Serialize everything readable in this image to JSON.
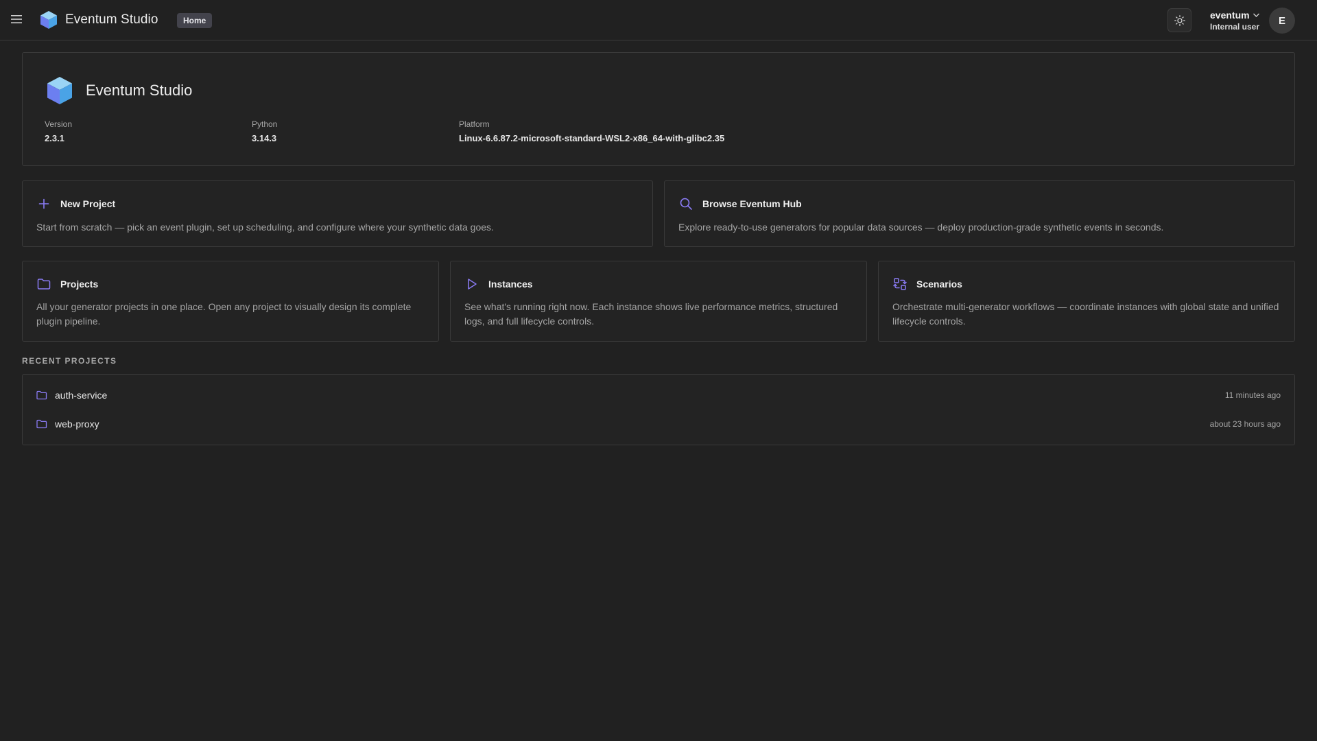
{
  "header": {
    "app_title": "Eventum Studio",
    "breadcrumb": "Home",
    "user": {
      "name": "eventum",
      "role": "Internal user",
      "avatar_initial": "E"
    }
  },
  "info": {
    "title": "Eventum Studio",
    "version_label": "Version",
    "version": "2.3.1",
    "python_label": "Python",
    "python": "3.14.3",
    "platform_label": "Platform",
    "platform": "Linux-6.6.87.2-microsoft-standard-WSL2-x86_64-with-glibc2.35"
  },
  "actions": {
    "new_project": {
      "title": "New Project",
      "description": "Start from scratch — pick an event plugin, set up scheduling, and configure where your synthetic data goes.",
      "icon": "plus-icon"
    },
    "browse_hub": {
      "title": "Browse Eventum Hub",
      "description": "Explore ready-to-use generators for popular data sources — deploy production-grade synthetic events in seconds.",
      "icon": "search-icon"
    },
    "projects": {
      "title": "Projects",
      "description": "All your generator projects in one place. Open any project to visually design its complete plugin pipeline.",
      "icon": "folder-icon"
    },
    "instances": {
      "title": "Instances",
      "description": "See what's running right now. Each instance shows live performance metrics, structured logs, and full lifecycle controls.",
      "icon": "play-icon"
    },
    "scenarios": {
      "title": "Scenarios",
      "description": "Orchestrate multi-generator workflows — coordinate instances with global state and unified lifecycle controls.",
      "icon": "workflow-icon"
    }
  },
  "recent": {
    "label": "RECENT PROJECTS",
    "items": [
      {
        "name": "auth-service",
        "time": "11 minutes ago"
      },
      {
        "name": "web-proxy",
        "time": "about 23 hours ago"
      }
    ]
  },
  "colors": {
    "background": "#212121",
    "accent": "#8b7cf6",
    "border": "#3a3a3a"
  }
}
